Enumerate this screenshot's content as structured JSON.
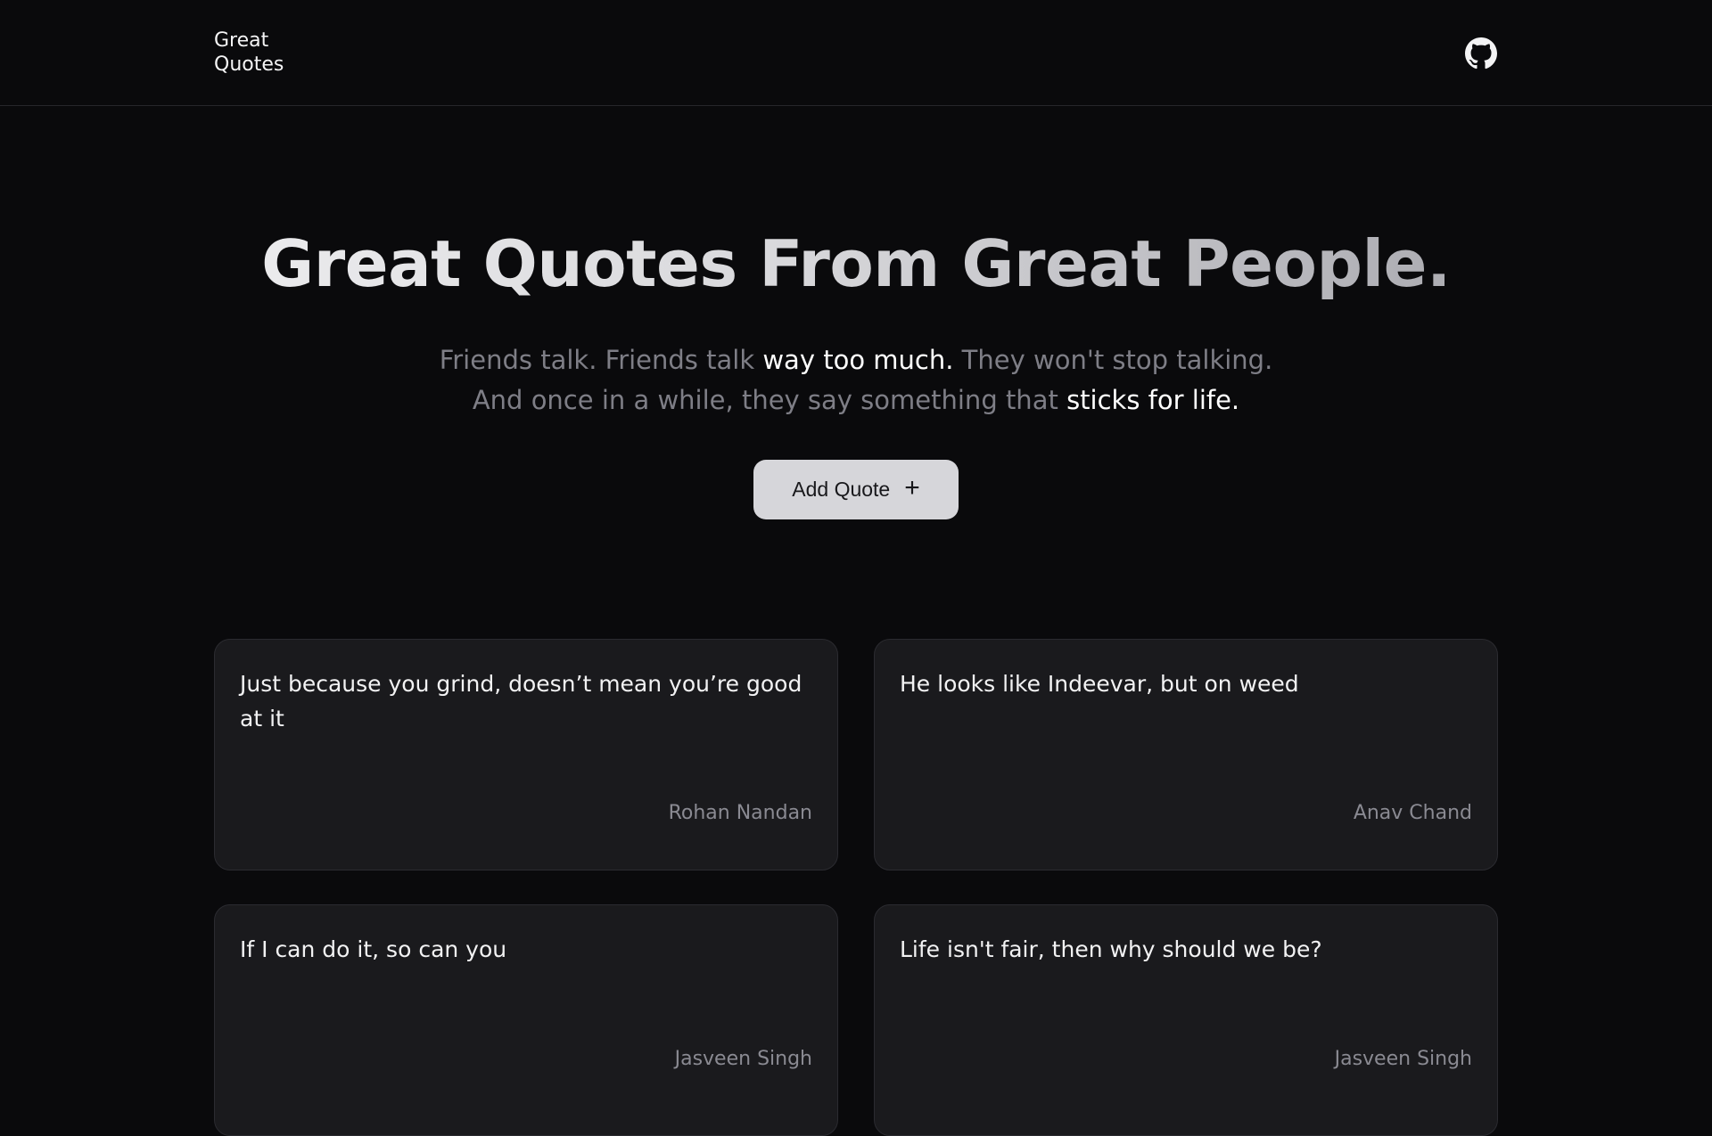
{
  "nav": {
    "brand_line1": "Great",
    "brand_line2": "Quotes",
    "github_icon": "github-icon"
  },
  "hero": {
    "title": "Great Quotes From Great People.",
    "sub_line1_a": "Friends talk. Friends talk ",
    "sub_line1_hl": "way too much.",
    "sub_line1_b": " They won't stop talking.",
    "sub_line2_a": "And once in a while, they say something that ",
    "sub_line2_hl": "sticks for life."
  },
  "add_button": {
    "label": "Add Quote",
    "icon": "+"
  },
  "quotes": [
    {
      "text": "Just because you grind, doesn’t mean you’re good at it",
      "author": "Rohan Nandan"
    },
    {
      "text": "He looks like Indeevar, but on weed",
      "author": "Anav Chand"
    },
    {
      "text": "If I can do it, so can you",
      "author": "Jasveen Singh"
    },
    {
      "text": "Life isn't fair, then why should we be?",
      "author": "Jasveen Singh"
    }
  ],
  "colors": {
    "background": "#0a0a0c",
    "card": "#1a1a1d",
    "button": "#d6d6da"
  }
}
